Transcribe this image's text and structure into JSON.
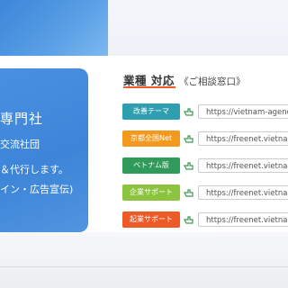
{
  "promo": {
    "line1": "専門社",
    "line2": "交流社団",
    "line3": "＆代行します。",
    "line4": "イン・広告宣伝)"
  },
  "section": {
    "title": "業種 対応",
    "subtitle": "《ご相談窓口》",
    "accent": "#ef5a28"
  },
  "rows": [
    {
      "label": "改善テーマ",
      "color": "#2e9fb0",
      "url": "https://vietnam-agency"
    },
    {
      "label": "京都全国Net",
      "color": "#f39a1e",
      "url": "https://freenet.vietnam"
    },
    {
      "label": "ベトナム版",
      "color": "#2f9a5a",
      "url": "https://freenet.vietnam"
    },
    {
      "label": "企業サポート",
      "color": "#8cc43f",
      "url": "https://freenet.vietnam"
    },
    {
      "label": "起業サポート",
      "color": "#ee5a26",
      "url": "https://freenet.vietnam"
    }
  ],
  "icons": {
    "link": "pointing-hand-icon"
  }
}
